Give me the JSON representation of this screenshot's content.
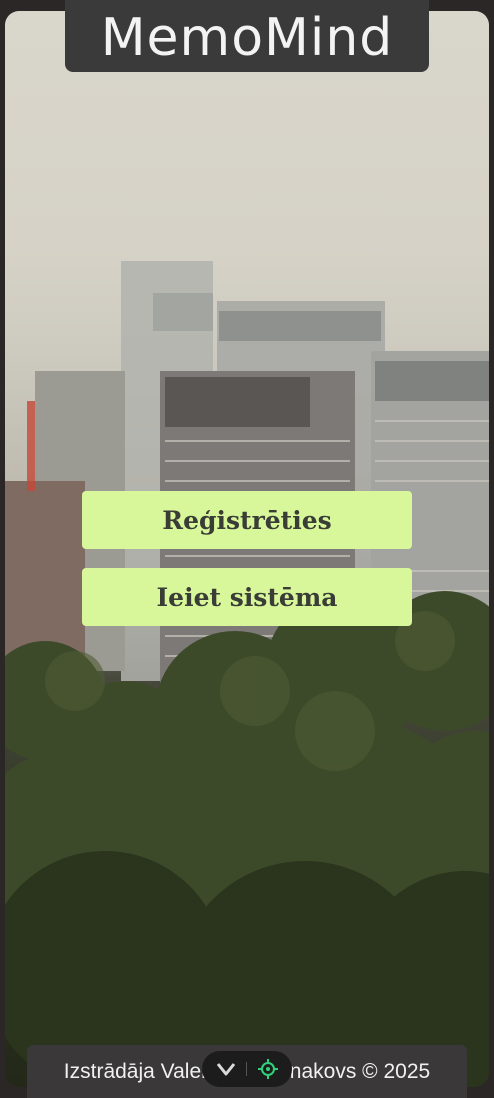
{
  "app": {
    "title": "MemoMind"
  },
  "actions": {
    "register_label": "Reģistrēties",
    "login_label": "Ieiet sistēma"
  },
  "footer": {
    "text": "Izstrādāja Valerijs Romanakovs © 2025"
  },
  "overlay": {
    "icons": [
      "chevron-down-icon",
      "crosshair-icon"
    ]
  },
  "colors": {
    "button_bg": "#d8f79a",
    "button_text": "#3a3d35",
    "title_bg": "#3b3a3b",
    "footer_bg": "#3a3838",
    "crosshair_accent": "#2fd17a"
  }
}
